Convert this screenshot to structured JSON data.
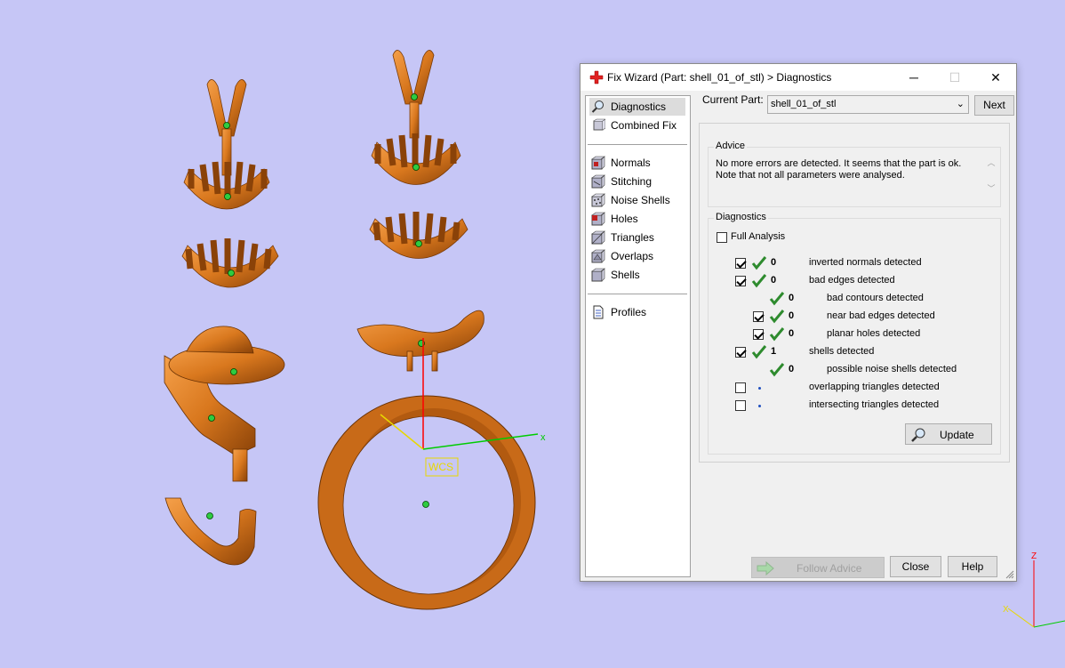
{
  "viewport": {
    "label_wcs": "WCS",
    "axis_x": "x",
    "corner_axis_z": "Z",
    "corner_axis_x": "X"
  },
  "dialog": {
    "title": "Fix Wizard (Part: shell_01_of_stl) > Diagnostics",
    "window_buttons": {
      "minimize": "─",
      "maximize": "☐",
      "close": "✕"
    }
  },
  "nav": {
    "top_items": [
      {
        "label": "Diagnostics",
        "icon": "magnifier-icon",
        "selected": true
      },
      {
        "label": "Combined Fix",
        "icon": "cube-stack-icon",
        "selected": false
      }
    ],
    "fix_items": [
      {
        "label": "Normals",
        "icon": "normals-cube-icon"
      },
      {
        "label": "Stitching",
        "icon": "stitching-cube-icon"
      },
      {
        "label": "Noise Shells",
        "icon": "noise-shells-icon"
      },
      {
        "label": "Holes",
        "icon": "holes-cube-icon"
      },
      {
        "label": "Triangles",
        "icon": "triangles-cube-icon"
      },
      {
        "label": "Overlaps",
        "icon": "overlaps-cube-icon"
      },
      {
        "label": "Shells",
        "icon": "shells-cube-icon"
      }
    ],
    "bottom_items": [
      {
        "label": "Profiles",
        "icon": "document-icon"
      }
    ]
  },
  "current_part": {
    "label": "Current Part:",
    "value": "shell_01_of_stl",
    "next_label": "Next"
  },
  "advice": {
    "title": "Advice",
    "line1": "No more errors are detected. It seems that the part is ok.",
    "line2": "Note that not all parameters were analysed."
  },
  "diagnostics": {
    "title": "Diagnostics",
    "full_analysis_label": "Full Analysis",
    "full_analysis_checked": false,
    "rows": [
      {
        "checkbox": true,
        "checked": true,
        "status": "ok",
        "count": "0",
        "text": "inverted normals detected",
        "indent": 0
      },
      {
        "checkbox": true,
        "checked": true,
        "status": "ok",
        "count": "0",
        "text": "bad edges detected",
        "indent": 0
      },
      {
        "checkbox": false,
        "checked": false,
        "status": "ok",
        "count": "0",
        "text": "bad contours detected",
        "indent": 1
      },
      {
        "checkbox": true,
        "checked": true,
        "status": "ok",
        "count": "0",
        "text": "near bad edges detected",
        "indent": 1
      },
      {
        "checkbox": true,
        "checked": true,
        "status": "ok",
        "count": "0",
        "text": "planar holes detected",
        "indent": 1
      },
      {
        "checkbox": true,
        "checked": true,
        "status": "ok",
        "count": "1",
        "text": "shells detected",
        "indent": 0
      },
      {
        "checkbox": false,
        "checked": false,
        "status": "ok",
        "count": "0",
        "text": "possible noise shells detected",
        "indent": 1
      },
      {
        "checkbox": true,
        "checked": false,
        "status": "pending",
        "count": "",
        "text": "overlapping triangles detected",
        "indent": 0
      },
      {
        "checkbox": true,
        "checked": false,
        "status": "pending",
        "count": "",
        "text": "intersecting triangles detected",
        "indent": 0
      }
    ],
    "update_label": "Update"
  },
  "footer": {
    "follow_advice_label": "Follow Advice",
    "close_label": "Close",
    "help_label": "Help"
  },
  "colors": {
    "background": "#c6c6f6",
    "model_orange": "#d9781e",
    "check_green": "#2e8b2e",
    "axis_red": "#ff0000",
    "axis_green": "#00cc00",
    "axis_yellow": "#e8d800"
  }
}
